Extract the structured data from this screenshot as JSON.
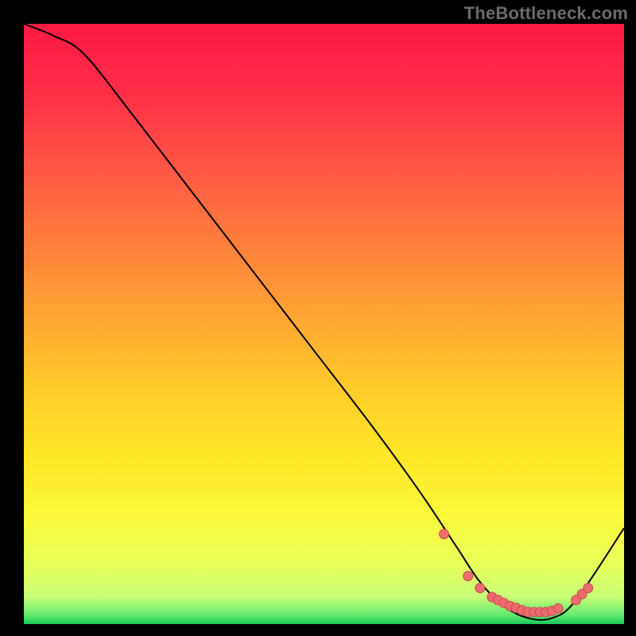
{
  "watermark": "TheBottleneck.com",
  "colors": {
    "gradient_stops": [
      {
        "offset": 0.0,
        "color": "#ff1a44"
      },
      {
        "offset": 0.1,
        "color": "#ff2a46"
      },
      {
        "offset": 0.22,
        "color": "#ff5046"
      },
      {
        "offset": 0.35,
        "color": "#ff7a3d"
      },
      {
        "offset": 0.48,
        "color": "#ffa334"
      },
      {
        "offset": 0.6,
        "color": "#ffc92a"
      },
      {
        "offset": 0.72,
        "color": "#ffe727"
      },
      {
        "offset": 0.82,
        "color": "#fbf73a"
      },
      {
        "offset": 0.9,
        "color": "#e8ff5a"
      },
      {
        "offset": 0.955,
        "color": "#c8ff77"
      },
      {
        "offset": 0.985,
        "color": "#63e86f"
      },
      {
        "offset": 1.0,
        "color": "#18c858"
      }
    ],
    "curve": "#000000",
    "marker_fill": "#ee6b6e",
    "marker_stroke": "#c84a50"
  },
  "chart_data": {
    "type": "line",
    "title": "",
    "xlabel": "",
    "ylabel": "",
    "xlim": [
      0,
      100
    ],
    "ylim": [
      0,
      100
    ],
    "grid": false,
    "legend": false,
    "series": [
      {
        "name": "bottleneck-curve",
        "x": [
          0,
          5,
          10,
          18,
          28,
          38,
          48,
          58,
          66,
          72,
          76,
          80,
          84,
          88,
          92,
          100
        ],
        "values": [
          100,
          98,
          95,
          85,
          72,
          59,
          46,
          33,
          22,
          13,
          7,
          3,
          1,
          1,
          4,
          16
        ]
      }
    ],
    "markers": {
      "name": "highlight-points",
      "x": [
        70,
        74,
        76,
        78,
        79,
        80,
        81,
        82,
        83,
        84,
        85,
        86,
        87,
        88,
        89,
        92,
        93,
        94
      ],
      "values": [
        15,
        8,
        6,
        4.5,
        4,
        3.5,
        3,
        2.7,
        2.3,
        2,
        2,
        2,
        2,
        2.2,
        2.6,
        4,
        5,
        6
      ]
    }
  }
}
